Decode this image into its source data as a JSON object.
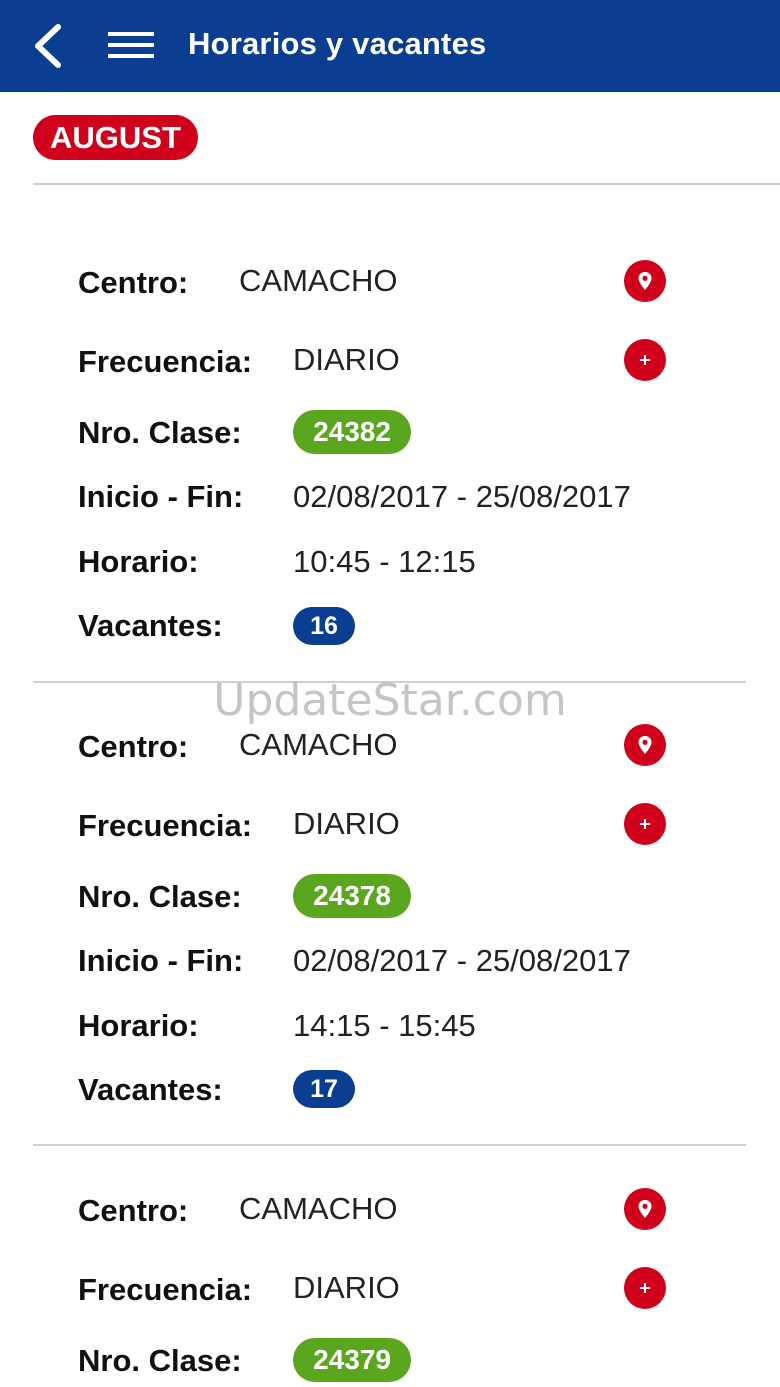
{
  "header": {
    "title": "Horarios y vacantes",
    "back_icon": "chevron-left-icon",
    "menu_icon": "hamburger-menu-icon",
    "color": "#0b3d91"
  },
  "month_badge": "AUGUST",
  "labels": {
    "centro": "Centro:",
    "frecuencia": "Frecuencia:",
    "nro_clase": "Nro. Clase:",
    "inicio_fin": "Inicio - Fin:",
    "horario": "Horario:",
    "vacantes": "Vacantes:"
  },
  "classes": [
    {
      "centro": "CAMACHO",
      "frecuencia": "DIARIO",
      "nro_clase": "24382",
      "inicio_fin": "02/08/2017 - 25/08/2017",
      "horario": "10:45 - 12:15",
      "vacantes": "16"
    },
    {
      "centro": "CAMACHO",
      "frecuencia": "DIARIO",
      "nro_clase": "24378",
      "inicio_fin": "02/08/2017 - 25/08/2017",
      "horario": "14:15 - 15:45",
      "vacantes": "17"
    },
    {
      "centro": "CAMACHO",
      "frecuencia": "DIARIO",
      "nro_clase": "24379"
    }
  ],
  "icons": {
    "location": "map-pin-icon",
    "add": "add-icon"
  },
  "colors": {
    "accent_red": "#d0021b",
    "class_green": "#5aa61e",
    "vacancy_blue": "#0b3d91"
  },
  "watermark": "UpdateStar.com"
}
